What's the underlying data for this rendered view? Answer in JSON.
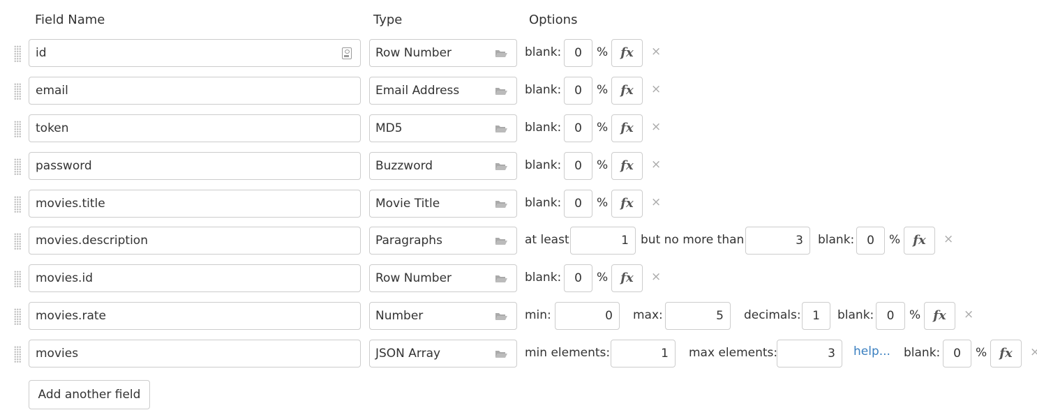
{
  "headers": {
    "field_name": "Field Name",
    "type": "Type",
    "options": "Options"
  },
  "rows": [
    {
      "name": "id",
      "type": "Row Number",
      "blank_label": "blank:",
      "blank": "0",
      "pct": "%"
    },
    {
      "name": "email",
      "type": "Email Address",
      "blank_label": "blank:",
      "blank": "0",
      "pct": "%"
    },
    {
      "name": "token",
      "type": "MD5",
      "blank_label": "blank:",
      "blank": "0",
      "pct": "%"
    },
    {
      "name": "password",
      "type": "Buzzword",
      "blank_label": "blank:",
      "blank": "0",
      "pct": "%"
    },
    {
      "name": "movies.title",
      "type": "Movie Title",
      "blank_label": "blank:",
      "blank": "0",
      "pct": "%"
    },
    {
      "name": "movies.description",
      "type": "Paragraphs",
      "at_least_label": "at least",
      "at_least": "1",
      "no_more_label": "but no more than",
      "no_more": "3",
      "blank_label": "blank:",
      "blank": "0",
      "pct": "%"
    },
    {
      "name": "movies.id",
      "type": "Row Number",
      "blank_label": "blank:",
      "blank": "0",
      "pct": "%"
    },
    {
      "name": "movies.rate",
      "type": "Number",
      "min_label": "min:",
      "min": "0",
      "max_label": "max:",
      "max": "5",
      "decimals_label": "decimals:",
      "decimals": "1",
      "blank_label": "blank:",
      "blank": "0",
      "pct": "%"
    },
    {
      "name": "movies",
      "type": "JSON Array",
      "min_el_label": "min elements:",
      "min_el": "1",
      "max_el_label": "max elements:",
      "max_el": "3",
      "help": "help...",
      "blank_label": "blank:",
      "blank": "0",
      "pct": "%"
    }
  ],
  "fx_label": "fx",
  "remove_glyph": "×",
  "add_button": "Add another field",
  "icons": {
    "name_field": "contact-card-icon",
    "type_picker": "folder-open-icon",
    "drag": "drag-handle-icon"
  },
  "colors": {
    "border": "#cccccc",
    "link": "#3a7fc0",
    "remove": "#aaaaaa"
  }
}
